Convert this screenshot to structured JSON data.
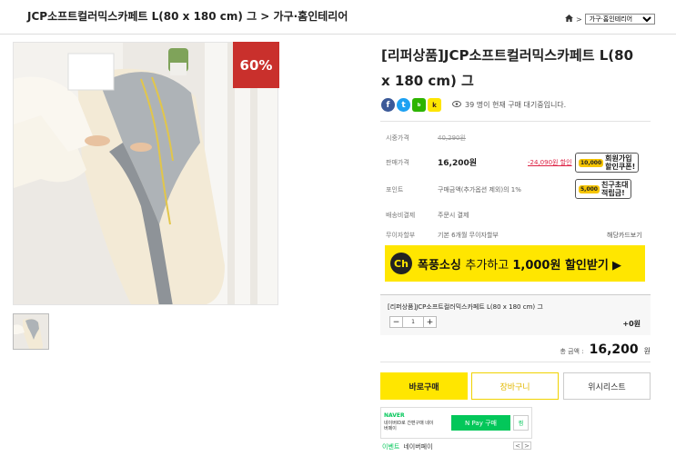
{
  "breadcrumb": "JCP소프트컬러믹스카페트 L(80 x 180 cm) 그 > 가구·홈인테리어",
  "location": {
    "home_icon": "home-icon",
    "arrow": ">",
    "category": "가구·홈인테리어"
  },
  "gallery": {
    "discount_badge": "60%"
  },
  "product": {
    "title_line1": "[리퍼상품]JCP소프트컬러믹스카페트 L(80",
    "title_line2": "x 180 cm) 그",
    "social_icons": [
      "facebook-icon",
      "twitter-icon",
      "band-icon",
      "kakaotalk-icon"
    ],
    "viewers_text": "39 명이 현재 구매 대기중입니다."
  },
  "info": {
    "list_price": {
      "label": "시중가격",
      "value": "40,290원"
    },
    "sale_price": {
      "label": "판매가격",
      "value": "16,200원",
      "discount": "-24,090원 할인"
    },
    "point": {
      "label": "포인트",
      "value": "구매금액(추가옵션 제외)의 1%"
    },
    "shipping": {
      "label": "배송비결제",
      "value": "주문시 결제"
    },
    "installment": {
      "label": "무이자할부",
      "value": "기본 6개월 무이자할부",
      "card_link": "해당카드보기"
    }
  },
  "coupons": {
    "signup": {
      "coin": "10,000",
      "line1": "회원가입",
      "line2": "할인쿠폰!"
    },
    "invite": {
      "coin": "5,000",
      "line1": "친구초대",
      "line2": "적립금!"
    }
  },
  "banner": {
    "badge": "Ch",
    "text_prefix": "폭풍소싱 ",
    "text_mid": "추가하고 ",
    "text_strong": "1,000원 할인받기",
    "arrow": "▶"
  },
  "option": {
    "name": "[리퍼상품]JCP소프트컬러믹스카페트 L(80 x 180 cm) 그",
    "minus": "−",
    "qty": "1",
    "plus": "+",
    "price": "+0원"
  },
  "total": {
    "label": "총 금액 :",
    "value": "16,200",
    "unit": "원"
  },
  "buttons": {
    "buy": "바로구매",
    "cart": "장바구니",
    "wishlist": "위시리스트"
  },
  "npay": {
    "brand": "NAVER",
    "desc": "네이버ID로 간편구매 네이버페이",
    "pay": "N Pay 구매",
    "zzim": "찜",
    "event_label": "이벤트",
    "event_text": "네이버페이",
    "prev": "<",
    "next": ">"
  },
  "colors": {
    "accent_yellow": "#ffe600",
    "badge_red": "#c9302c",
    "naver_green": "#03c75a"
  }
}
